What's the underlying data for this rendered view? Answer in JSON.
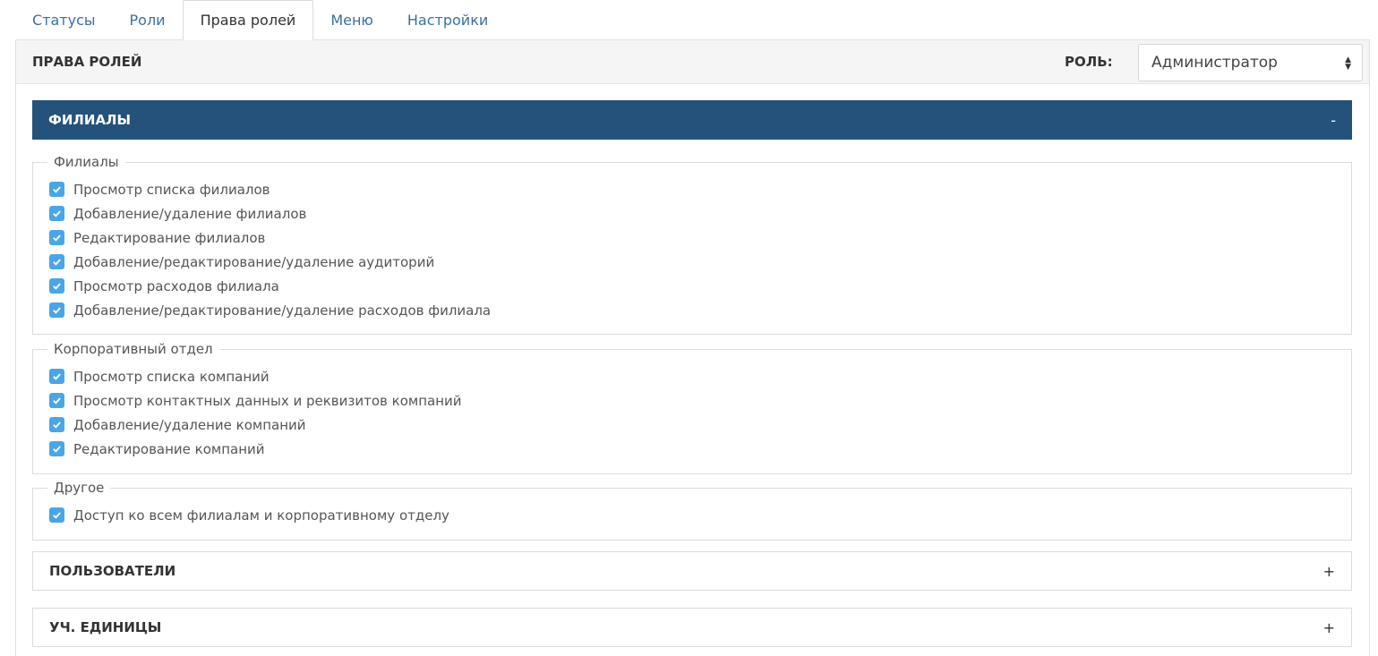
{
  "tabs": [
    {
      "label": "Статусы"
    },
    {
      "label": "Роли"
    },
    {
      "label": "Права ролей",
      "active": true
    },
    {
      "label": "Меню"
    },
    {
      "label": "Настройки"
    }
  ],
  "header": {
    "title": "ПРАВА РОЛЕЙ",
    "role_label": "РОЛЬ:",
    "role_value": "Администратор"
  },
  "sections": [
    {
      "title": "ФИЛИАЛЫ",
      "toggle": "-",
      "groups": [
        {
          "legend": "Филиалы",
          "items": [
            "Просмотр списка филиалов",
            "Добавление/удаление филиалов",
            "Редактирование филиалов",
            "Добавление/редактирование/удаление аудиторий",
            "Просмотр расходов филиала",
            "Добавление/редактирование/удаление расходов филиала"
          ]
        },
        {
          "legend": "Корпоративный отдел",
          "items": [
            "Просмотр списка компаний",
            "Просмотр контактных данных и реквизитов компаний",
            "Добавление/удаление компаний",
            "Редактирование компаний"
          ]
        },
        {
          "legend": "Другое",
          "items": [
            "Доступ ко всем филиалам и корпоративному отделу"
          ]
        }
      ]
    },
    {
      "title": "ПОЛЬЗОВАТЕЛИ",
      "toggle": "+"
    },
    {
      "title": "УЧ. ЕДИНИЦЫ",
      "toggle": "+"
    }
  ],
  "colors": {
    "tab_link": "#3a70a3",
    "section_open_bg": "#24527b",
    "checkbox": "#4aa6e6"
  }
}
